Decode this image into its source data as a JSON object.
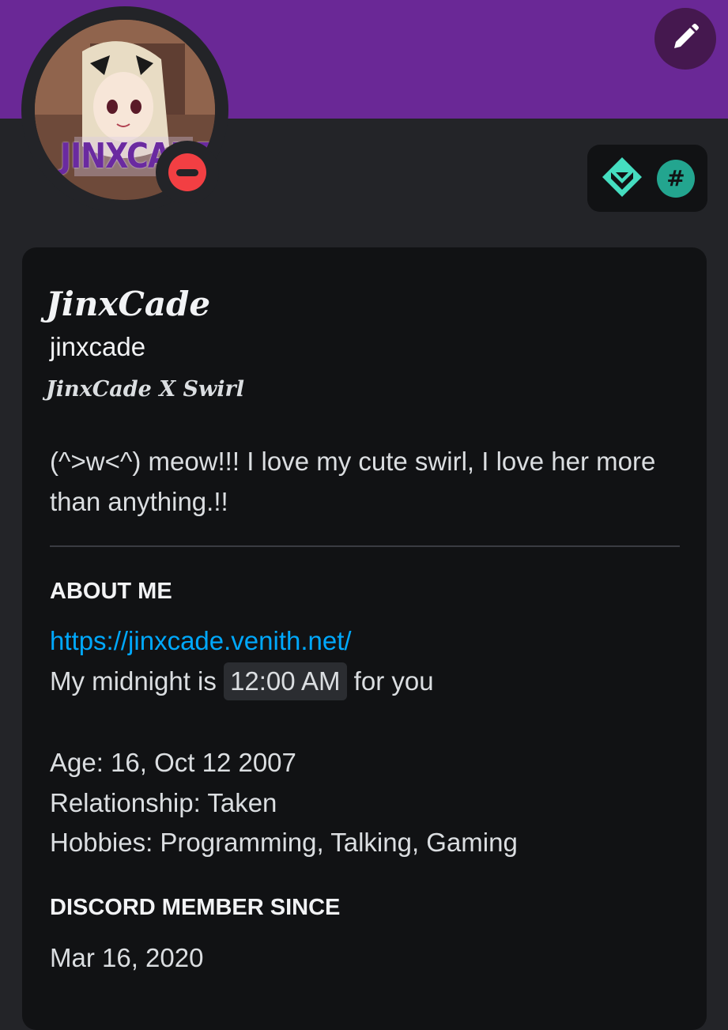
{
  "colors": {
    "banner": "#6a2896",
    "background": "#232428",
    "card": "#111214",
    "link": "#00a8fc",
    "status_dnd": "#f23f43",
    "badge_accent": "#23a58f"
  },
  "header": {
    "edit_icon": "pencil-icon",
    "avatar_text": "JINXCADE",
    "status": "do-not-disturb",
    "badges": [
      {
        "icon": "hypesquad-balance-icon"
      },
      {
        "icon": "hash-badge-icon",
        "glyph": "#"
      }
    ]
  },
  "profile": {
    "display_name": "JinxCade",
    "username": "jinxcade",
    "pronouns": "JinxCade X Swirl",
    "custom_status": "(^>w<^) meow!!! I love my cute swirl, I love her more than anything.!!"
  },
  "about_me": {
    "heading": "ABOUT ME",
    "link": "https://jinxcade.venith.net/",
    "midnight_prefix": "My midnight is",
    "midnight_time": "12:00 AM",
    "midnight_suffix": "for you",
    "age": "Age: 16, Oct 12 2007",
    "relationship": "Relationship: Taken",
    "hobbies": "Hobbies: Programming, Talking, Gaming"
  },
  "member_since": {
    "heading": "DISCORD MEMBER SINCE",
    "date": "Mar 16, 2020"
  }
}
